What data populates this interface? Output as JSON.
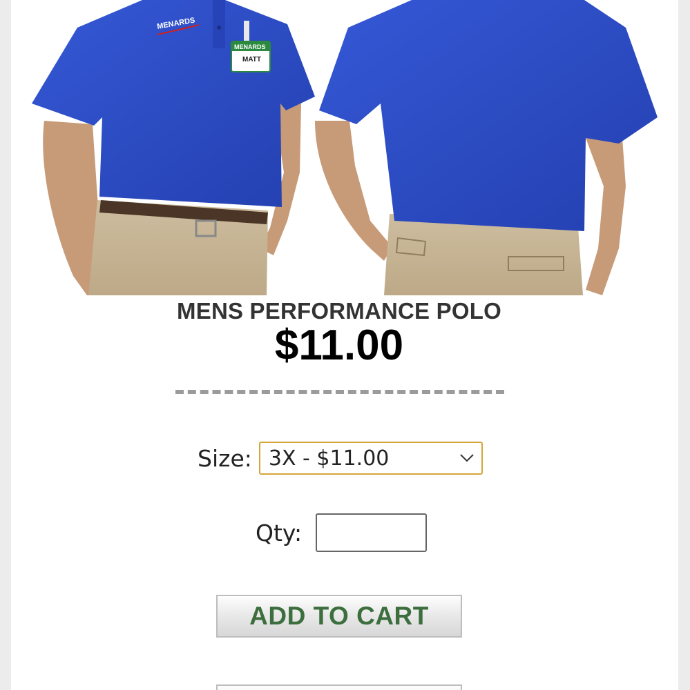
{
  "product": {
    "title": "MENS PERFORMANCE POLO",
    "price": "$11.00",
    "photo": {
      "front_logo_text": "MENARDS",
      "badge_brand": "MENARDS",
      "badge_name": "MATT",
      "shirt_color": "#2f4fc4",
      "pants_color": "#c8b79a"
    }
  },
  "form": {
    "size_label": "Size:",
    "size_selected": "3X - $11.00",
    "qty_label": "Qty:",
    "qty_value": ""
  },
  "actions": {
    "add_to_cart_label": "ADD TO CART"
  },
  "colors": {
    "select_border": "#d4a53a",
    "cart_text": "#3c6e3e",
    "divider": "#9b9b9b"
  }
}
